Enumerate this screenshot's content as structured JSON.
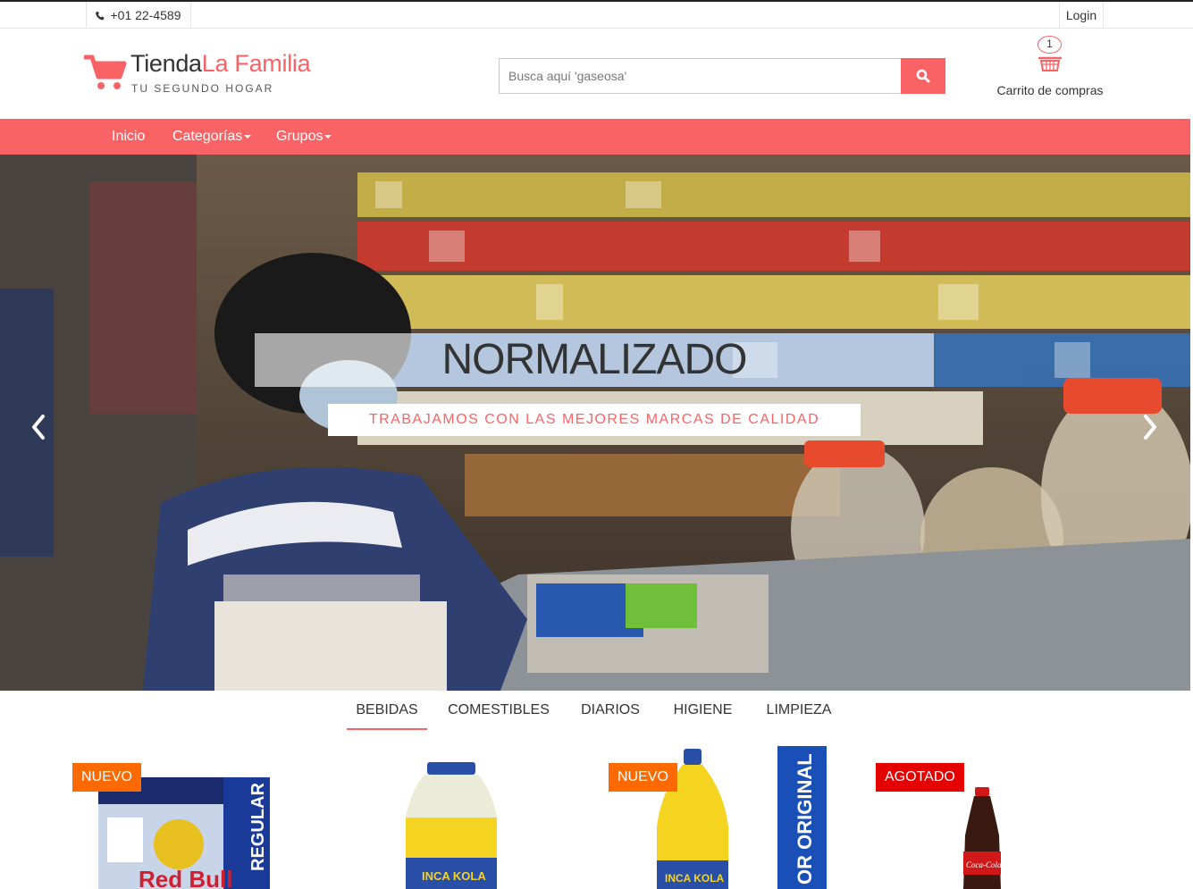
{
  "topbar": {
    "phone": "+01 22-4589",
    "login": "Login"
  },
  "brand": {
    "name_part1": "Tienda",
    "name_part2": "La Familia",
    "tagline": "TU SEGUNDO HOGAR",
    "accent": "#f96365"
  },
  "search": {
    "placeholder": "Busca aquí 'gaseosa'",
    "icon": "search-icon"
  },
  "cart": {
    "count": "1",
    "label": "Carrito de compras",
    "icon": "basket-icon"
  },
  "nav": {
    "items": [
      {
        "label": "Inicio"
      },
      {
        "label": "Categorías"
      },
      {
        "label": "Grupos"
      }
    ]
  },
  "hero": {
    "title": "NORMALIZADO",
    "subtitle": "TRABAJAMOS CON LAS MEJORES MARCAS DE CALIDAD",
    "prev_icon": "chevron-left-icon",
    "next_icon": "chevron-right-icon"
  },
  "tabs": [
    {
      "label": "BEBIDAS"
    },
    {
      "label": "COMESTIBLES"
    },
    {
      "label": "DIARIOS"
    },
    {
      "label": "HIGIENE"
    },
    {
      "label": "LIMPIEZA"
    }
  ],
  "active_tab": "BEBIDAS",
  "products": [
    {
      "badge": "NUEVO",
      "image_text": "REGULAR",
      "brand_text": "Red Bull"
    },
    {
      "badge": "",
      "brand_text": "INCA KOLA"
    },
    {
      "badge": "NUEVO",
      "image_text": "OR ORIGINAL",
      "brand_text": "INCA KOLA"
    },
    {
      "badge": "AGOTADO",
      "brand_text": "Coca-Cola"
    }
  ],
  "colors": {
    "accent": "#f96365",
    "badge_new": "#ff6a00",
    "badge_out": "#e50000"
  }
}
